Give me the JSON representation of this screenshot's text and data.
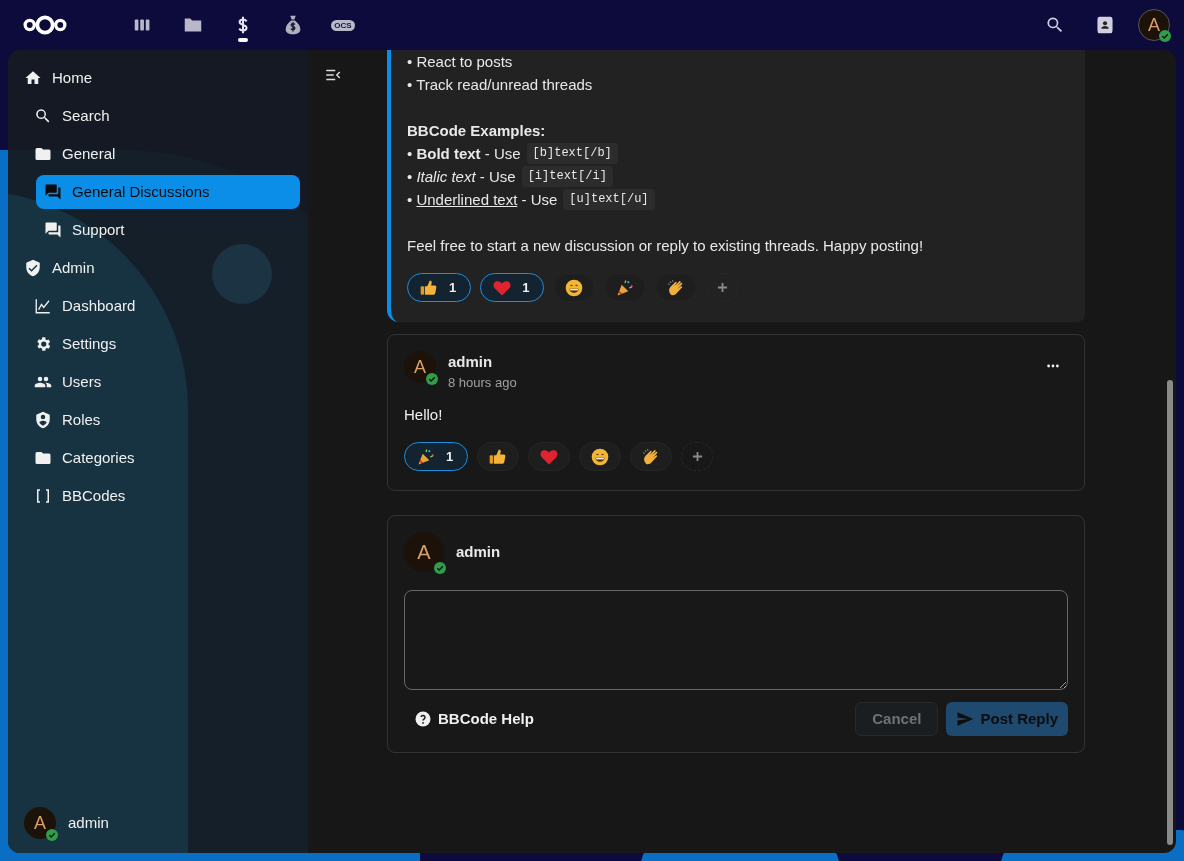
{
  "topbar": {
    "apps": [
      {
        "kind": "dashboard",
        "selected": false
      },
      {
        "kind": "files",
        "selected": false
      },
      {
        "kind": "dollar",
        "selected": true
      },
      {
        "kind": "money-bag",
        "selected": false
      },
      {
        "kind": "badge",
        "label": "OCS",
        "selected": false
      }
    ],
    "avatar": {
      "letter": "A",
      "online": true
    }
  },
  "sidebar": {
    "items": [
      {
        "kind": "home",
        "label": "Home",
        "selected": false,
        "children": [
          {
            "kind": "search",
            "label": "Search",
            "selected": false
          },
          {
            "kind": "folder",
            "label": "General",
            "selected": false,
            "children": [
              {
                "kind": "chat",
                "label": "General Discussions",
                "selected": true
              },
              {
                "kind": "chat",
                "label": "Support",
                "selected": false
              }
            ]
          }
        ]
      },
      {
        "kind": "shield-check",
        "label": "Admin",
        "selected": false,
        "children": [
          {
            "kind": "chart",
            "label": "Dashboard",
            "selected": false
          },
          {
            "kind": "gear",
            "label": "Settings",
            "selected": false
          },
          {
            "kind": "users",
            "label": "Users",
            "selected": false
          },
          {
            "kind": "shield-user",
            "label": "Roles",
            "selected": false
          },
          {
            "kind": "folder",
            "label": "Categories",
            "selected": false
          },
          {
            "kind": "brackets",
            "label": "BBCodes",
            "selected": false
          }
        ]
      }
    ],
    "user": {
      "avatar": "A",
      "online": true,
      "name": "admin"
    }
  },
  "posts": [
    {
      "highlighted": true,
      "body": [
        {
          "kind": "paragraph",
          "text": "• React to posts"
        },
        {
          "kind": "paragraph",
          "text": "• Track read/unread threads"
        },
        {
          "kind": "gap"
        },
        {
          "kind": "heading",
          "text": "BBCode Examples:"
        },
        {
          "kind": "bold",
          "bullet": "•",
          "label": "Bold text",
          "rest": "- Use",
          "code": "[b]text[/b]"
        },
        {
          "kind": "italic",
          "bullet": "•",
          "label": "Italic text",
          "rest": "- Use",
          "code": "[i]text[/i]"
        },
        {
          "kind": "underline",
          "bullet": "•",
          "label": "Underlined text",
          "rest": "- Use",
          "code": "[u]text[/u]"
        },
        {
          "kind": "gap"
        },
        {
          "kind": "paragraph",
          "text": "Feel free to start a new discussion or reply to existing threads. Happy posting!"
        }
      ],
      "reactions": [
        {
          "kind": "thumbs-up",
          "count": "1",
          "selected": true
        },
        {
          "kind": "heart",
          "count": "1",
          "selected": true
        },
        {
          "kind": "grin",
          "selected": false
        },
        {
          "kind": "party",
          "selected": false
        },
        {
          "kind": "clap",
          "selected": false
        }
      ]
    },
    {
      "highlighted": false,
      "author": "admin",
      "avatar": "A",
      "online": true,
      "time": "8 hours ago",
      "body": [
        {
          "kind": "paragraph",
          "text": "Hello!"
        }
      ],
      "reactions": [
        {
          "kind": "party",
          "count": "1",
          "selected": true
        },
        {
          "kind": "thumbs-up",
          "selected": false
        },
        {
          "kind": "heart",
          "selected": false
        },
        {
          "kind": "grin",
          "selected": false
        },
        {
          "kind": "clap",
          "selected": false
        }
      ]
    }
  ],
  "composer": {
    "author": "admin",
    "avatar": "A",
    "online": true,
    "help": "BBCode Help",
    "cancel": {
      "label": "Cancel",
      "disabled": true
    },
    "submit": {
      "label": "Post Reply",
      "disabled": true
    }
  }
}
